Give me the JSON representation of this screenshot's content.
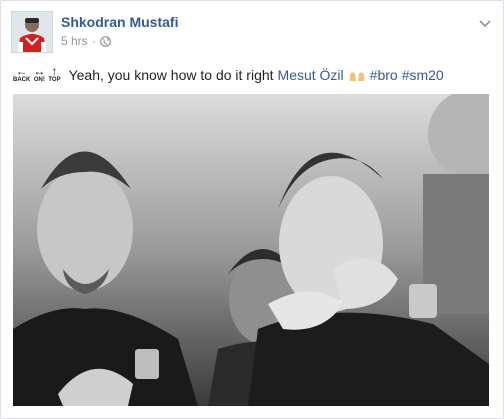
{
  "post": {
    "author": "Shkodran Mustafi",
    "time": "5 hrs",
    "separator": "·",
    "emoji_labels": {
      "back": "BACK",
      "on": "ON!",
      "top": "TOP"
    },
    "text": "Yeah, you know how to do it right",
    "mention": "Mesut Özil",
    "hashtags": [
      "#bro",
      "#sm20"
    ]
  },
  "icons": {
    "avatar": "avatar",
    "audience": "globe-icon",
    "menu": "chevron-down-icon",
    "emojis": [
      "back-arrow-icon",
      "on-arrow-icon",
      "top-arrow-icon",
      "raised-hands-icon"
    ]
  },
  "colors": {
    "link": "#365899",
    "meta": "#90949c",
    "text": "#1d2129",
    "border": "#dddfe2"
  }
}
